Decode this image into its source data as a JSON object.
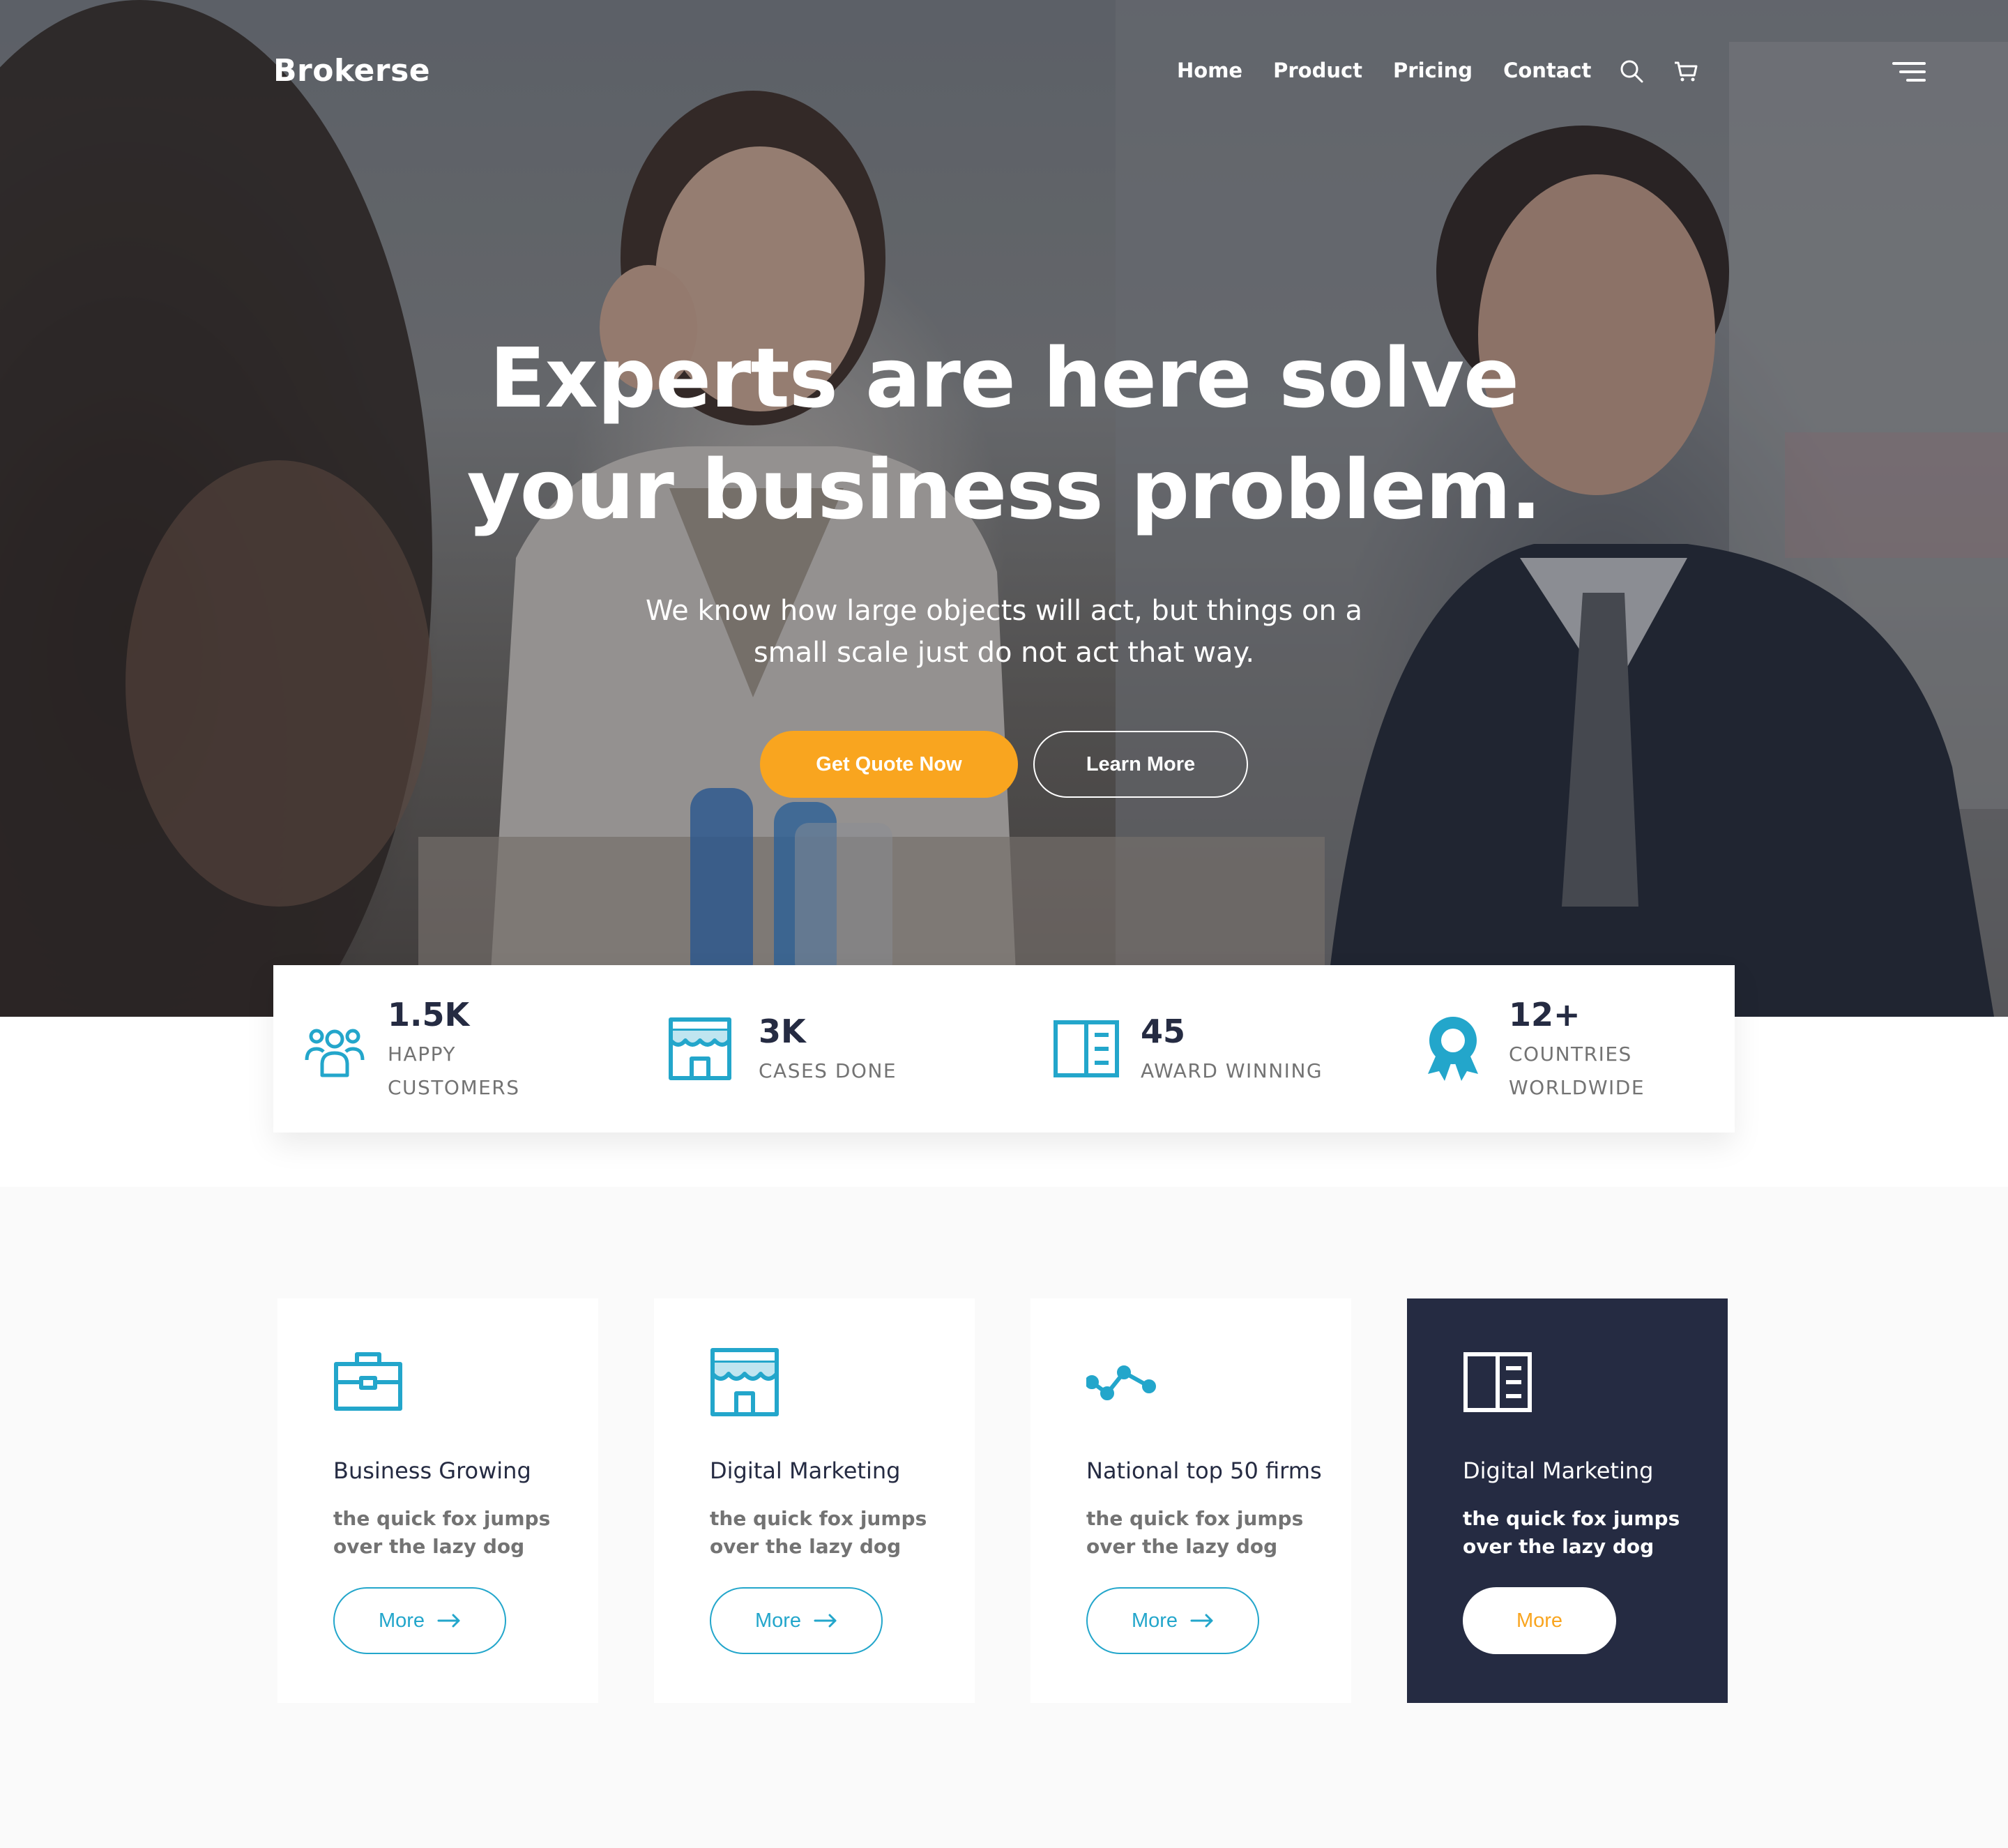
{
  "nav": {
    "brand": "Brokerse",
    "menu": [
      {
        "label": "Home"
      },
      {
        "label": "Product"
      },
      {
        "label": "Pricing"
      },
      {
        "label": "Contact"
      }
    ],
    "icons": [
      "search-icon",
      "cart-icon",
      "menu-icon"
    ]
  },
  "hero": {
    "title_line1": "Experts are here solve",
    "title_line2": "your business problem.",
    "subtitle_line1": "We know how large objects will act, but things on a",
    "subtitle_line2": "small scale just do not act that way.",
    "primary_button": "Get Quote Now",
    "secondary_button": "Learn More"
  },
  "stats": [
    {
      "icon": "users-icon",
      "value": "1.5K",
      "label_line1": "HAPPY",
      "label_line2": "CUSTOMERS"
    },
    {
      "icon": "store-icon",
      "value": "3K",
      "label_line1": "CASES DONE",
      "label_line2": ""
    },
    {
      "icon": "book-icon",
      "value": "45",
      "label_line1": "AWARD WINNING",
      "label_line2": ""
    },
    {
      "icon": "award-icon",
      "value": "12+",
      "label_line1": "COUNTRIES",
      "label_line2": "WORLDWIDE"
    }
  ],
  "cards": [
    {
      "icon": "briefcase-icon",
      "title": "Business Growing",
      "text_line1": "the quick fox jumps",
      "text_line2": "over the lazy dog",
      "button": "More"
    },
    {
      "icon": "store-icon",
      "title": "Digital Marketing",
      "text_line1": "the quick fox jumps",
      "text_line2": "over the lazy dog",
      "button": "More"
    },
    {
      "icon": "trend-icon",
      "title": "National top 50 firms",
      "text_line1": "the quick fox jumps",
      "text_line2": "over the lazy dog",
      "button": "More"
    },
    {
      "icon": "book-icon",
      "title": "Digital Marketing",
      "text_line1": "the quick fox jumps",
      "text_line2": "over the lazy dog",
      "button": "More"
    }
  ],
  "colors": {
    "primary": "#23a6cb",
    "accent": "#f9a51f",
    "dark": "#252b42",
    "muted": "#737373"
  }
}
